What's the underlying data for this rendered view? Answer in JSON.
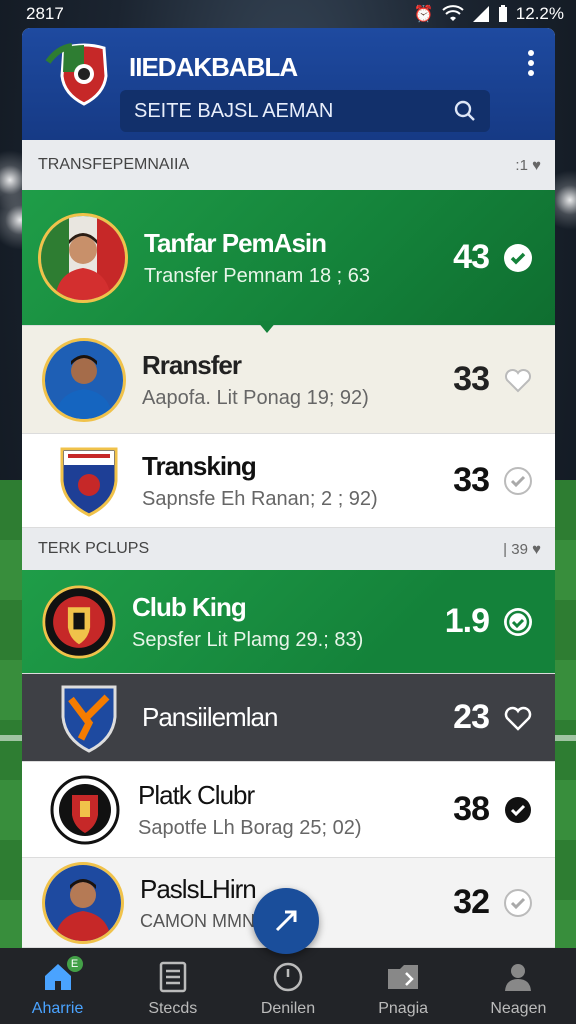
{
  "status": {
    "time": "2817",
    "battery": "12.2%"
  },
  "app": {
    "title": "IIEDAKBABLA"
  },
  "search": {
    "value": "SEITE BAJSL AEMAN"
  },
  "section1": {
    "title": "TRANSFEPEMNAIIA",
    "meta": ":1"
  },
  "section2": {
    "title": "TERK PCLUPS",
    "meta": "39"
  },
  "rows": [
    {
      "title": "Tanfar PemAsin",
      "subtitle": "Transfer Pemnam 18 ; 63",
      "value": "43",
      "liked": true
    },
    {
      "title": "Rransfer",
      "subtitle": "Aapofa. Lit Ponag 19; 92)",
      "value": "33",
      "liked": false
    },
    {
      "title": "Transking",
      "subtitle": "Sapnsfe Eh Ranan; 2 ; 92)",
      "value": "33",
      "liked": false
    },
    {
      "title": "Club King",
      "subtitle": "Sepsfer Lit Plamg 29.; 83)",
      "value": "1.9",
      "liked": true
    },
    {
      "title": "Pansiilemlan",
      "subtitle": "",
      "value": "23",
      "liked": false
    },
    {
      "title": "Platk Clubr",
      "subtitle": "Sapotfe Lh Borag 25; 02)",
      "value": "38",
      "liked": true
    },
    {
      "title": "PaslsLHirn",
      "subtitle": "CAMON MMN",
      "value": "32",
      "liked": false
    }
  ],
  "nav": [
    {
      "label": "Aharrie",
      "icon": "home-icon",
      "badge": "E"
    },
    {
      "label": "Stecds",
      "icon": "list-icon"
    },
    {
      "label": "Denilen",
      "icon": "clock-icon"
    },
    {
      "label": "Pnagia",
      "icon": "folder-icon"
    },
    {
      "label": "Neagen",
      "icon": "person-icon"
    }
  ],
  "colors": {
    "header": "#1e4aa0",
    "green": "#14823a",
    "accent": "#4aa3ff",
    "gold": "#f0c24a"
  }
}
